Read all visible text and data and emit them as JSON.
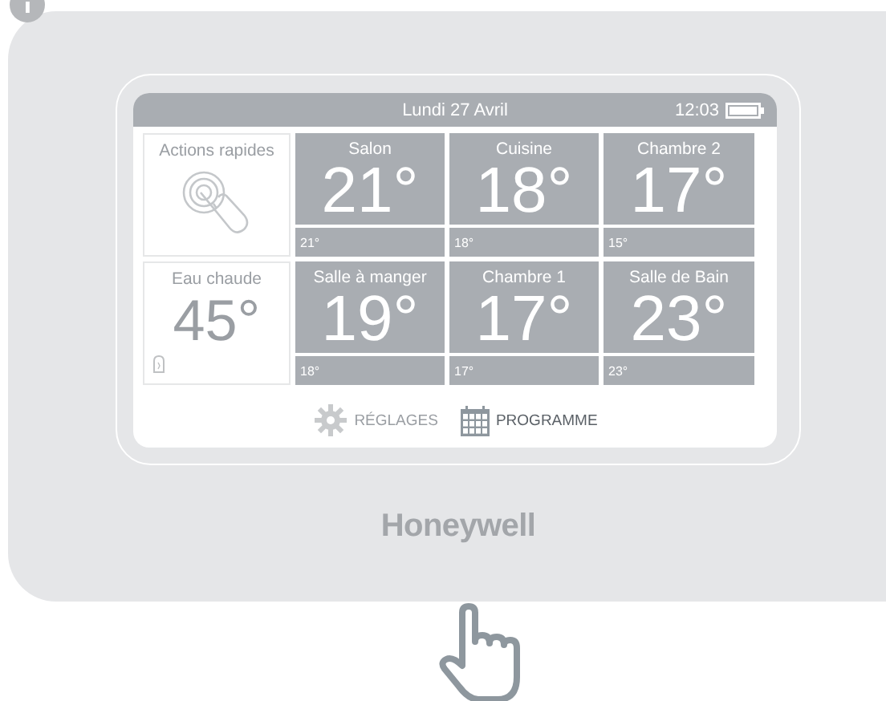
{
  "screen": {
    "date": "Lundi 27 Avril",
    "time": "12:03"
  },
  "quick_actions": {
    "label": "Actions rapides"
  },
  "hot_water": {
    "label": "Eau chaude",
    "temperature": "45°"
  },
  "rooms": [
    {
      "name": "Salon",
      "setpoint": "21°",
      "current": "21°"
    },
    {
      "name": "Cuisine",
      "setpoint": "18°",
      "current": "18°"
    },
    {
      "name": "Chambre 2",
      "setpoint": "17°",
      "current": "15°"
    },
    {
      "name": "Salle à manger",
      "setpoint": "19°",
      "current": "18°"
    },
    {
      "name": "Chambre 1",
      "setpoint": "17°",
      "current": "17°"
    },
    {
      "name": "Salle de Bain",
      "setpoint": "23°",
      "current": "23°"
    }
  ],
  "nav": [
    {
      "kind": "settings",
      "label": "RÉGLAGES",
      "selected": false
    },
    {
      "kind": "schedule",
      "label": "PROGRAMME",
      "selected": true
    }
  ],
  "brand": "Honeywell"
}
